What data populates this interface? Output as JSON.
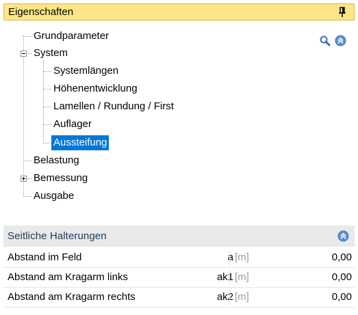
{
  "panel": {
    "title": "Eigenschaften"
  },
  "tree": {
    "items": [
      {
        "label": "Grundparameter"
      },
      {
        "label": "System"
      },
      {
        "label": "Systemlängen"
      },
      {
        "label": "Höhenentwicklung"
      },
      {
        "label": "Lamellen / Rundung / First"
      },
      {
        "label": "Auflager"
      },
      {
        "label": "Aussteifung",
        "selected": true
      },
      {
        "label": "Belastung"
      },
      {
        "label": "Bemessung"
      },
      {
        "label": "Ausgabe"
      }
    ]
  },
  "section": {
    "title": "Seitliche Halterungen"
  },
  "properties": {
    "rows": [
      {
        "name": "Abstand im Feld",
        "symbol": "a",
        "unit": "[m]",
        "value": "0,00"
      },
      {
        "name": "Abstand am Kragarm links",
        "symbol": "ak1",
        "unit": "[m]",
        "value": "0,00"
      },
      {
        "name": "Abstand am Kragarm rechts",
        "symbol": "ak2",
        "unit": "[m]",
        "value": "0,00"
      }
    ]
  },
  "icons": {
    "pin": "pin-icon",
    "search": "search-icon",
    "collapse": "collapse-all-icon",
    "section_collapse": "section-collapse-icon"
  },
  "colors": {
    "title_bar": "#fde687",
    "selection": "#0078d7",
    "section_header": "#e9e9e9",
    "accent_icon": "#3f78c9"
  }
}
